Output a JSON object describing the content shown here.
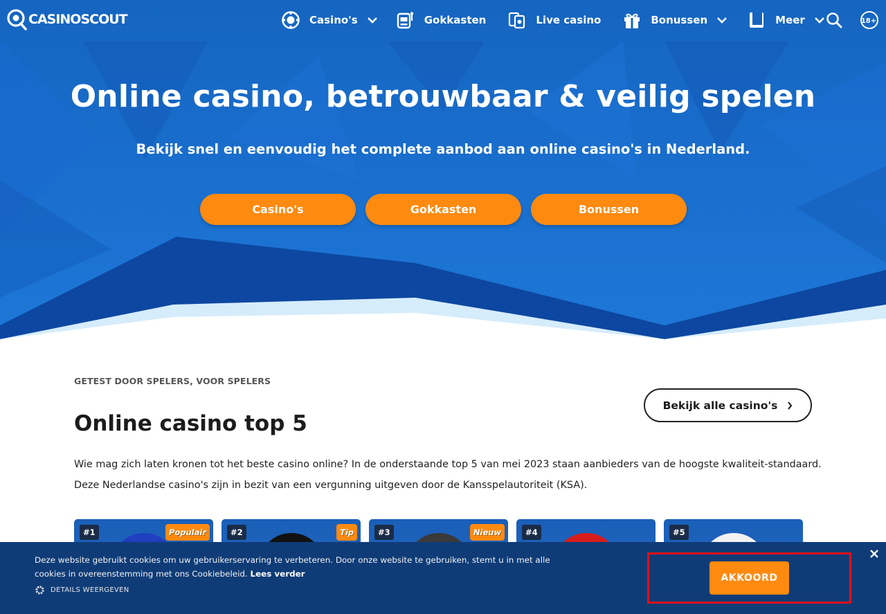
{
  "brand": {
    "name": "CASINOSCOUT",
    "accent": "#ff8a10",
    "primary": "#1565c0",
    "cookie_bg": "#0f3c77",
    "highlight": "#e2101a"
  },
  "nav": {
    "items": [
      {
        "label": "Casino's",
        "icon": "chip-icon",
        "dropdown": true
      },
      {
        "label": "Gokkasten",
        "icon": "slot-machine-icon",
        "dropdown": false
      },
      {
        "label": "Live casino",
        "icon": "cards-icon",
        "dropdown": false
      },
      {
        "label": "Bonussen",
        "icon": "gift-icon",
        "dropdown": true
      },
      {
        "label": "Meer",
        "icon": "book-icon",
        "dropdown": true
      }
    ],
    "search_icon": "search-icon",
    "age_badge": "18+"
  },
  "hero": {
    "title": "Online casino, betrouwbaar & veilig spelen",
    "subtitle": "Bekijk snel en eenvoudig het complete aanbod aan online casino's in Nederland.",
    "buttons": [
      "Casino's",
      "Gokkasten",
      "Bonussen"
    ]
  },
  "top5": {
    "eyebrow": "GETEST DOOR SPELERS, VOOR SPELERS",
    "title": "Online casino top 5",
    "all_button": "Bekijk alle casino's",
    "intro": "Wie mag zich laten kronen tot het beste casino online? In de onderstaande top 5 van mei 2023 staan aanbieders van de hoogste kwaliteit-standaard. Deze Nederlandse casino's zijn in bezit van een vergunning uitgeven door de Kansspelautoriteit (KSA).",
    "cards": [
      {
        "rank": "#1",
        "tag": "Populair",
        "logo_color": "#1f3fbf"
      },
      {
        "rank": "#2",
        "tag": "Tip",
        "logo_color": "#111111"
      },
      {
        "rank": "#3",
        "tag": "Nieuw",
        "logo_color": "#3a3a3a"
      },
      {
        "rank": "#4",
        "tag": "",
        "logo_color": "#d81c1c"
      },
      {
        "rank": "#5",
        "tag": "",
        "logo_color": "#f2f2f2"
      }
    ]
  },
  "cookie": {
    "text": "Deze website gebruikt cookies om uw gebruikerservaring te verbeteren. Door onze website te gebruiken, stemt u in met alle cookies in overeenstemming met ons Cookiebeleid.",
    "more_link": "Lees verder",
    "details": "DETAILS WEERGEVEN",
    "accept": "AKKOORD"
  }
}
